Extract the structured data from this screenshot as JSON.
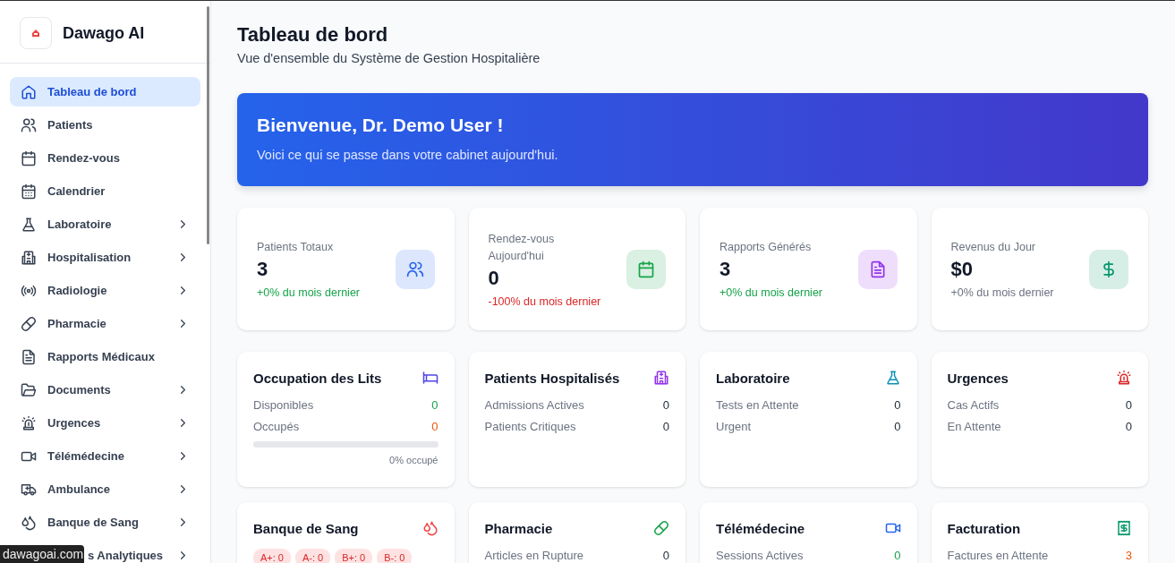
{
  "sidebar": {
    "brand": "Dawago AI",
    "items": [
      {
        "label": "Tableau de bord",
        "selected": true,
        "expandable": false
      },
      {
        "label": "Patients",
        "selected": false,
        "expandable": false
      },
      {
        "label": "Rendez-vous",
        "selected": false,
        "expandable": false
      },
      {
        "label": "Calendrier",
        "selected": false,
        "expandable": false
      },
      {
        "label": "Laboratoire",
        "selected": false,
        "expandable": true
      },
      {
        "label": "Hospitalisation",
        "selected": false,
        "expandable": true
      },
      {
        "label": "Radiologie",
        "selected": false,
        "expandable": true
      },
      {
        "label": "Pharmacie",
        "selected": false,
        "expandable": true
      },
      {
        "label": "Rapports Médicaux",
        "selected": false,
        "expandable": false
      },
      {
        "label": "Documents",
        "selected": false,
        "expandable": true
      },
      {
        "label": "Urgences",
        "selected": false,
        "expandable": true
      },
      {
        "label": "Télémédecine",
        "selected": false,
        "expandable": true
      },
      {
        "label": "Ambulance",
        "selected": false,
        "expandable": true
      },
      {
        "label": "Banque de Sang",
        "selected": false,
        "expandable": true
      },
      {
        "label": "s Analytiques",
        "selected": false,
        "expandable": true,
        "kind": "covered"
      }
    ]
  },
  "status_url": "dawagoai.com",
  "header": {
    "title": "Tableau de bord",
    "subtitle": "Vue d'ensemble du Système de Gestion Hospitalière"
  },
  "banner": {
    "title": "Bienvenue, Dr. Demo User !",
    "text": "Voici ce qui se passe dans votre cabinet aujourd'hui."
  },
  "stats": [
    {
      "label": "Patients Totaux",
      "value": "3",
      "change": {
        "text": "+0% du mois dernier",
        "color": "#16a34a"
      },
      "icon": {
        "color": "#2563eb"
      }
    },
    {
      "label": "Rendez-vous Aujourd'hui",
      "value": "0",
      "change": {
        "text": "-100% du mois dernier",
        "color": "#dc2626"
      },
      "icon": {
        "color": "#16a34a"
      }
    },
    {
      "label": "Rapports Générés",
      "value": "3",
      "change": {
        "text": "+0% du mois dernier",
        "color": "#16a34a"
      },
      "icon": {
        "color": "#9333ea"
      }
    },
    {
      "label": "Revenus du Jour",
      "value": "$0",
      "change": {
        "text": "+0% du mois dernier",
        "color": "#6b7280"
      },
      "icon": {
        "color": "#059669"
      }
    }
  ],
  "panels": [
    {
      "title": "Occupation des Lits",
      "icon": {
        "color": "#4f46e5"
      },
      "rows": [
        {
          "label": "Disponibles",
          "value": "0",
          "color": "#16a34a"
        },
        {
          "label": "Occupés",
          "value": "0",
          "color": "#ea580c"
        }
      ],
      "progress": {
        "level": 0,
        "caption": "0% occupé"
      }
    },
    {
      "title": "Patients Hospitalisés",
      "icon": {
        "color": "#9333ea"
      },
      "rows": [
        {
          "label": "Admissions Actives",
          "value": "0"
        },
        {
          "label": "Patients Critiques",
          "value": "0"
        }
      ]
    },
    {
      "title": "Laboratoire",
      "icon": {
        "color": "#0891b2"
      },
      "rows": [
        {
          "label": "Tests en Attente",
          "value": "0"
        },
        {
          "label": "Urgent",
          "value": "0"
        }
      ]
    },
    {
      "title": "Urgences",
      "icon": {
        "color": "#dc2626"
      },
      "rows": [
        {
          "label": "Cas Actifs",
          "value": "0"
        },
        {
          "label": "En Attente",
          "value": "0"
        }
      ]
    },
    {
      "title": "Banque de Sang",
      "icon": {
        "color": "#ef4444"
      },
      "tags": [
        "A+: 0",
        "A-: 0",
        "B+: 0",
        "B-: 0"
      ]
    },
    {
      "title": "Pharmacie",
      "icon": {
        "color": "#16a34a"
      },
      "rows": [
        {
          "label": "Articles en Rupture",
          "value": "0"
        }
      ]
    },
    {
      "title": "Télémédecine",
      "icon": {
        "color": "#2563eb"
      },
      "rows": [
        {
          "label": "Sessions Actives",
          "value": "0",
          "color": "#16a34a"
        }
      ]
    },
    {
      "title": "Facturation",
      "icon": {
        "color": "#059669"
      },
      "rows": [
        {
          "label": "Factures en Attente",
          "value": "3",
          "color": "#ea580c"
        }
      ]
    }
  ]
}
